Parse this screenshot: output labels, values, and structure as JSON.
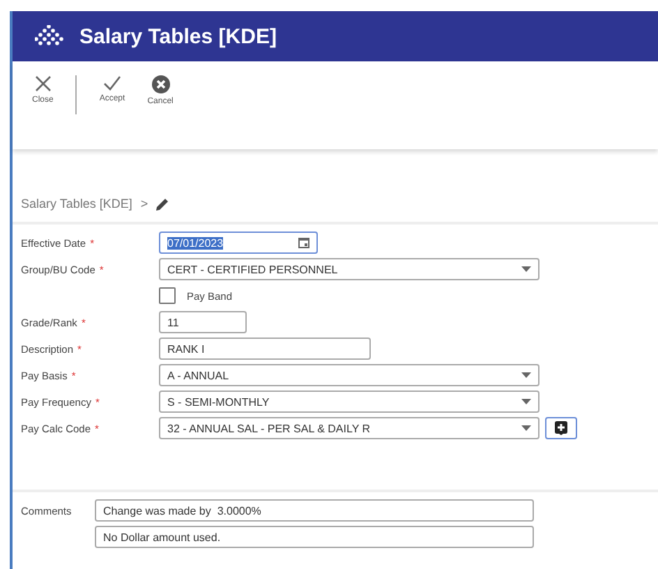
{
  "window": {
    "title": "Salary Tables [KDE]"
  },
  "toolbar": [
    {
      "label": "Close",
      "kind": "close"
    },
    {
      "label": "Accept",
      "kind": "accept"
    },
    {
      "label": "Cancel",
      "kind": "cancel"
    }
  ],
  "breadcrumb": {
    "text": "Salary Tables [KDE]",
    "separator": ">"
  },
  "form": [
    {
      "kind": "date",
      "label": "Effective Date",
      "marker": "*",
      "value": "07/01/2023",
      "highlighted": true
    },
    {
      "kind": "select",
      "label": "Group/BU Code",
      "marker": "*",
      "value": "CERT - CERTIFIED PERSONNEL"
    },
    {
      "kind": "checkbox",
      "label": "Pay Band",
      "checked": false
    },
    {
      "kind": "short",
      "label": "Grade/Rank",
      "marker": "*",
      "value": "11"
    },
    {
      "kind": "text",
      "label": "Description",
      "marker": "*",
      "value": "RANK I"
    },
    {
      "kind": "select",
      "label": "Pay Basis",
      "marker": "*",
      "value": "A - ANNUAL"
    },
    {
      "kind": "select",
      "label": "Pay Frequency",
      "marker": "*",
      "value": "S - SEMI-MONTHLY"
    },
    {
      "kind": "select-add",
      "label": "Pay Calc Code",
      "marker": "*",
      "value": "32 - ANNUAL SAL - PER SAL & DAILY R"
    }
  ],
  "comments": {
    "label": "Comments",
    "lines": [
      "Change was made by  3.0000%",
      "No Dollar amount used."
    ]
  }
}
